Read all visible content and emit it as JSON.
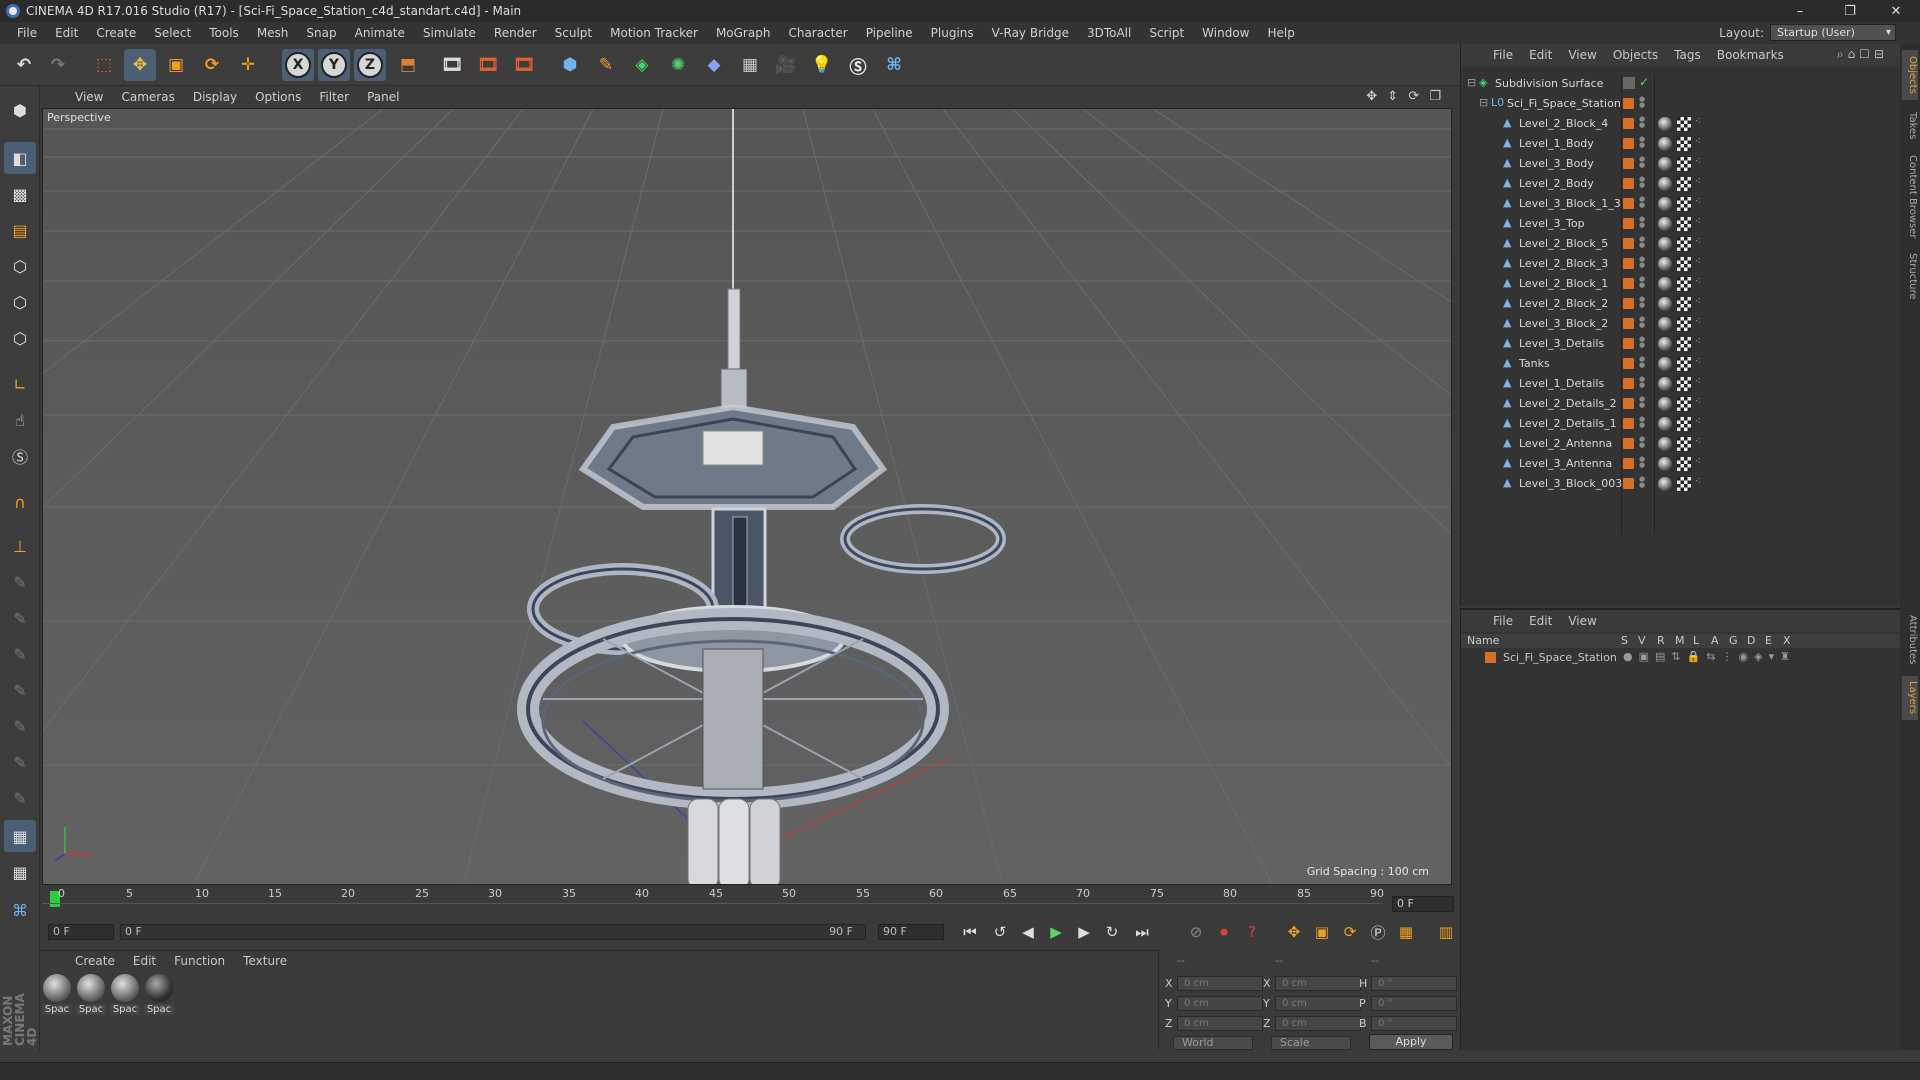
{
  "window": {
    "title": "CINEMA 4D R17.016 Studio (R17) - [Sci-Fi_Space_Station_c4d_standart.c4d] - Main",
    "controls": [
      "–",
      "❐",
      "✕"
    ]
  },
  "menubar": {
    "items": [
      "File",
      "Edit",
      "Create",
      "Select",
      "Tools",
      "Mesh",
      "Snap",
      "Animate",
      "Simulate",
      "Render",
      "Sculpt",
      "Motion Tracker",
      "MoGraph",
      "Character",
      "Pipeline",
      "Plugins",
      "V-Ray Bridge",
      "3DToAll",
      "Script",
      "Window",
      "Help"
    ],
    "layout_label": "Layout:",
    "layout_value": "Startup (User)"
  },
  "toolbar": {
    "undo": "↶",
    "redo": "↷",
    "axis_x": "X",
    "axis_y": "Y",
    "axis_z": "Z"
  },
  "viewport": {
    "menu": [
      "View",
      "Cameras",
      "Display",
      "Options",
      "Filter",
      "Panel"
    ],
    "label": "Perspective",
    "grid_spacing": "Grid Spacing : 100 cm",
    "nav_icons": "✥ ⇕ ⟳ ❐"
  },
  "timeline": {
    "ticks": [
      "0",
      "5",
      "10",
      "15",
      "20",
      "25",
      "30",
      "35",
      "40",
      "45",
      "50",
      "55",
      "60",
      "65",
      "70",
      "75",
      "80",
      "85",
      "90"
    ],
    "end_frame_field": "0 F"
  },
  "transport": {
    "current_frame": "0 F",
    "range_start": "0 F",
    "range_end": "90 F",
    "max_frame": "90 F"
  },
  "materials": {
    "menu": [
      "Create",
      "Edit",
      "Function",
      "Texture"
    ],
    "items": [
      "Spac",
      "Spac",
      "Spac",
      "Spac"
    ]
  },
  "coordinates": {
    "header": [
      "--",
      "--",
      "--"
    ],
    "rows": [
      {
        "a": "X",
        "av": "0 cm",
        "b": "X",
        "bv": "0 cm",
        "c": "H",
        "cv": "0 °"
      },
      {
        "a": "Y",
        "av": "0 cm",
        "b": "Y",
        "bv": "0 cm",
        "c": "P",
        "cv": "0 °"
      },
      {
        "a": "Z",
        "av": "0 cm",
        "b": "Z",
        "bv": "0 cm",
        "c": "B",
        "cv": "0 °"
      }
    ],
    "space": "World",
    "mode": "Scale",
    "apply": "Apply"
  },
  "object_manager": {
    "menu": [
      "File",
      "Edit",
      "View",
      "Objects",
      "Tags",
      "Bookmarks"
    ],
    "root": "Subdivision Surface",
    "group": "Sci_Fi_Space_Station",
    "objects": [
      "Level_2_Block_4",
      "Level_1_Body",
      "Level_3_Body",
      "Level_2_Body",
      "Level_3_Block_1_3",
      "Level_3_Top",
      "Level_2_Block_5",
      "Level_2_Block_3",
      "Level_2_Block_1",
      "Level_2_Block_2",
      "Level_3_Block_2",
      "Level_3_Details",
      "Tanks",
      "Level_1_Details",
      "Level_2_Details_2",
      "Level_2_Details_1",
      "Level_2_Antenna",
      "Level_3_Antenna",
      "Level_3_Block_003"
    ]
  },
  "layer_manager": {
    "menu": [
      "File",
      "Edit",
      "View"
    ],
    "columns": [
      "Name",
      "S",
      "V",
      "R",
      "M",
      "L",
      "A",
      "G",
      "D",
      "E",
      "X"
    ],
    "layers": [
      "Sci_Fi_Space_Station"
    ]
  },
  "right_tabs": [
    "Objects",
    "Takes",
    "Content Browser",
    "Structure",
    "Attributes",
    "Layers"
  ],
  "brand": "MAXON CINEMA 4D",
  "colors": {
    "accent": "#4b5e74",
    "layer": "#d86f28",
    "play": "#5fd35f",
    "record": "#e04040"
  }
}
